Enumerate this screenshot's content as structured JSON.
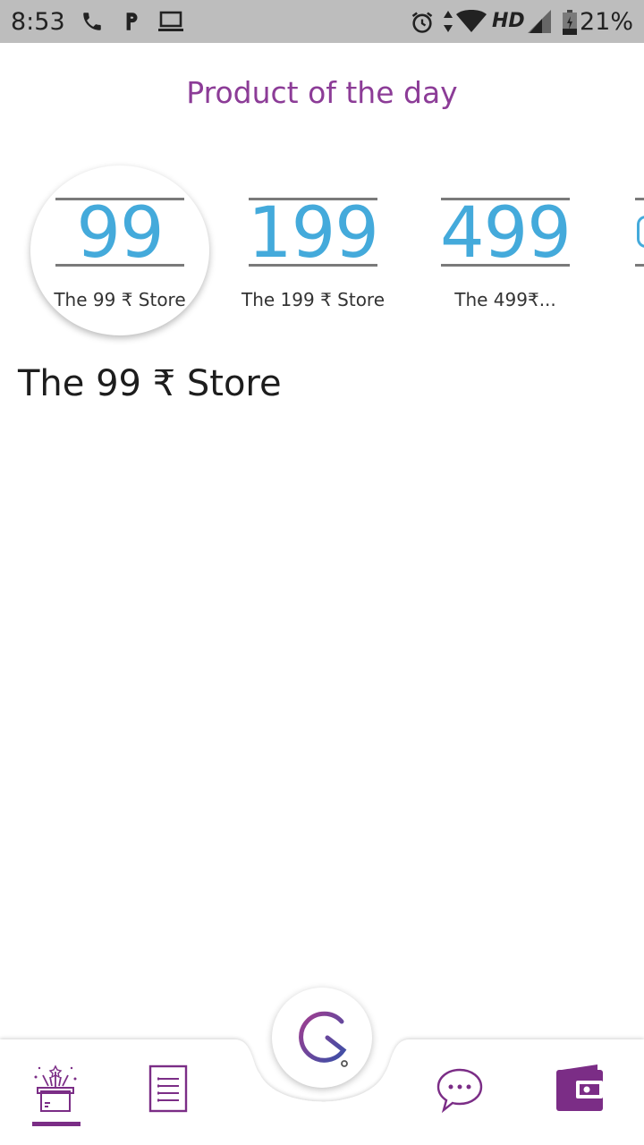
{
  "status_bar": {
    "time": "8:53",
    "network": "HD",
    "battery": "21%",
    "icons": [
      "phone-icon",
      "parking-icon",
      "laptop-icon",
      "alarm-icon",
      "data-arrows-icon",
      "wifi-icon",
      "signal-icon",
      "battery-icon"
    ]
  },
  "header": {
    "title": "Product of the day"
  },
  "stores": [
    {
      "number": "99",
      "label": "The 99 ₹ Store",
      "selected": true
    },
    {
      "number": "199",
      "label": "The 199 ₹ Store",
      "selected": false
    },
    {
      "number": "499",
      "label": "The 499₹...",
      "selected": false
    }
  ],
  "section": {
    "title": "The 99 ₹ Store"
  },
  "nav": {
    "items": [
      "gift-box-icon",
      "list-icon",
      "logo-icon",
      "chat-icon",
      "wallet-icon"
    ],
    "accent": "#8c3c97",
    "active": "gift-box"
  },
  "colors": {
    "accent": "#8c3c97",
    "store_number": "#44aadb",
    "status_bar": "#bdbdbd"
  }
}
